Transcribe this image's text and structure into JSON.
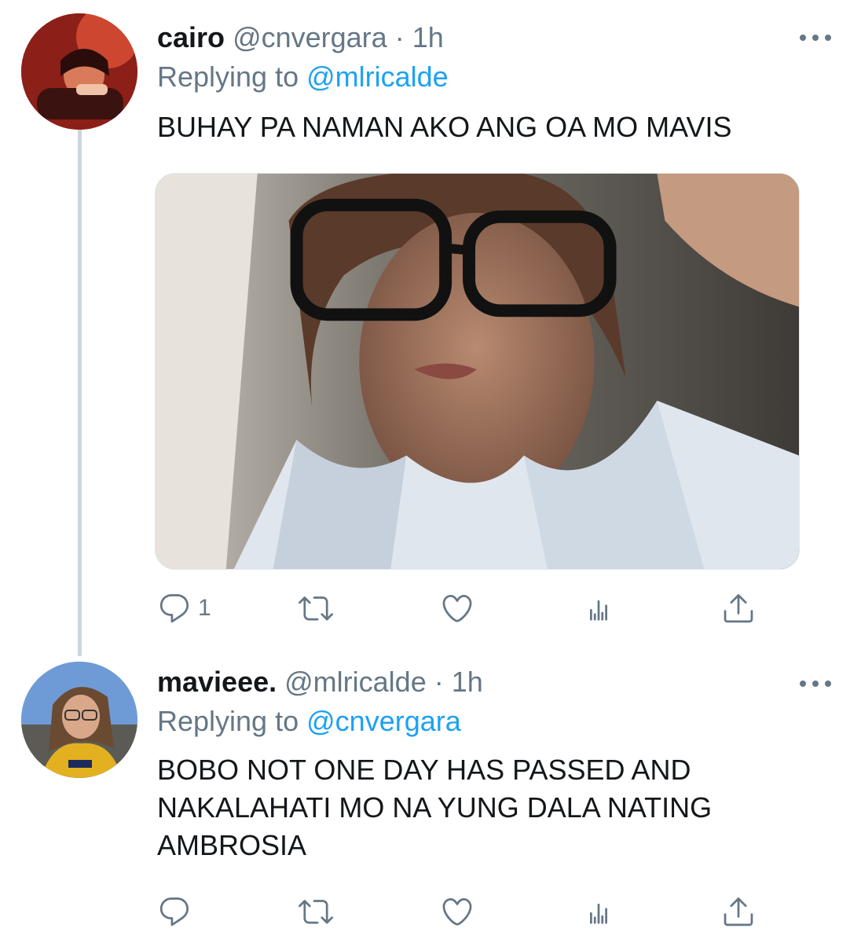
{
  "colors": {
    "text": "#14171a",
    "secondary": "#657786",
    "link": "#1da1f2",
    "thread_line": "#ccd6dd"
  },
  "tweets": [
    {
      "display_name": "cairo",
      "handle": "@cnvergara",
      "separator": "·",
      "time": "1h",
      "replying_label": "Replying to",
      "replying_to": "@mlricalde",
      "text": "BUHAY PA NAMAN AKO ANG OA MO MAVIS",
      "has_media": true,
      "reply_count": "1",
      "icons": [
        "reply-icon",
        "retweet-icon",
        "like-icon",
        "analytics-icon",
        "share-icon",
        "more-icon"
      ]
    },
    {
      "display_name": "mavieee.",
      "handle": "@mlricalde",
      "separator": "·",
      "time": "1h",
      "replying_label": "Replying to",
      "replying_to": "@cnvergara",
      "text": "BOBO NOT ONE DAY HAS PASSED AND NAKALAHATI MO NA YUNG DALA NATING AMBROSIA",
      "has_media": false,
      "reply_count": "",
      "icons": [
        "reply-icon",
        "retweet-icon",
        "like-icon",
        "analytics-icon",
        "share-icon",
        "more-icon"
      ]
    }
  ]
}
